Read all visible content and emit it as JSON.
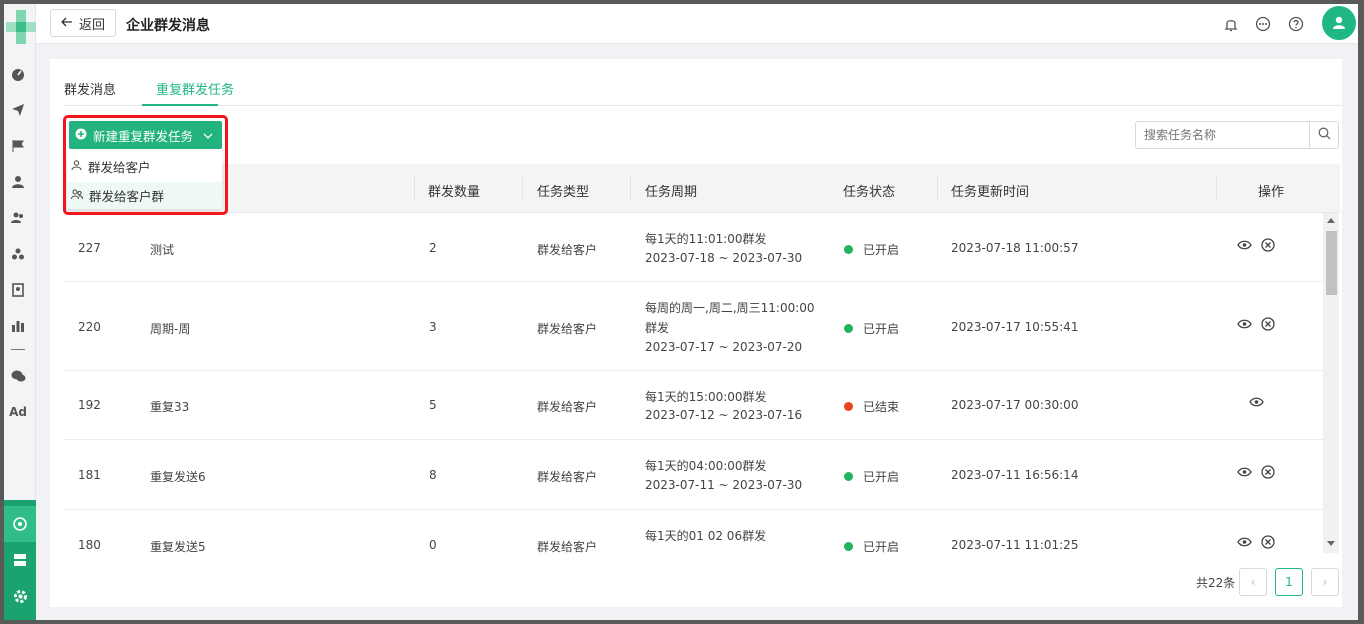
{
  "header": {
    "back_label": "返回",
    "title": "企业群发消息"
  },
  "tabs": [
    {
      "label": "群发消息",
      "active": false
    },
    {
      "label": "重复群发任务",
      "active": true
    }
  ],
  "new_task_dropdown": {
    "button_label": "新建重复群发任务",
    "items": [
      {
        "label": "群发给客户",
        "icon": "user-icon"
      },
      {
        "label": "群发给客户群",
        "icon": "user-group-icon"
      }
    ]
  },
  "search": {
    "placeholder": "搜索任务名称"
  },
  "table": {
    "columns": [
      "群发数量",
      "任务类型",
      "任务周期",
      "任务状态",
      "任务更新时间",
      "操作"
    ],
    "rows": [
      {
        "id": "227",
        "name": "测试",
        "count": "2",
        "type": "群发给客户",
        "period_line1": "每1天的11:01:00群发",
        "period_line2": "",
        "period_range": "2023-07-18 ~ 2023-07-30",
        "status": "已开启",
        "status_color": "#22b35e",
        "updated": "2023-07-18 11:00:57",
        "can_stop": true
      },
      {
        "id": "220",
        "name": "周期-周",
        "count": "3",
        "type": "群发给客户",
        "period_line1": "每周的周一,周二,周三11:00:00",
        "period_line2": "群发",
        "period_range": "2023-07-17 ~ 2023-07-20",
        "status": "已开启",
        "status_color": "#22b35e",
        "updated": "2023-07-17 10:55:41",
        "can_stop": true
      },
      {
        "id": "192",
        "name": "重复33",
        "count": "5",
        "type": "群发给客户",
        "period_line1": "每1天的15:00:00群发",
        "period_line2": "",
        "period_range": "2023-07-12 ~ 2023-07-16",
        "status": "已结束",
        "status_color": "#e8431a",
        "updated": "2023-07-17 00:30:00",
        "can_stop": false
      },
      {
        "id": "181",
        "name": "重复发送6",
        "count": "8",
        "type": "群发给客户",
        "period_line1": "每1天的04:00:00群发",
        "period_line2": "",
        "period_range": "2023-07-11 ~ 2023-07-30",
        "status": "已开启",
        "status_color": "#22b35e",
        "updated": "2023-07-11 16:56:14",
        "can_stop": true
      },
      {
        "id": "180",
        "name": "重复发送5",
        "count": "0",
        "type": "群发给客户",
        "period_line1": "每1天的01 02 06群发",
        "period_line2": "",
        "period_range": "",
        "status": "已开启",
        "status_color": "#22b35e",
        "updated": "2023-07-11 11:01:25",
        "can_stop": true
      }
    ]
  },
  "pagination": {
    "total_label": "共22条",
    "current_page": "1",
    "prev": "‹",
    "next": "›"
  },
  "colors": {
    "brand": "#1fb883",
    "active": "#22b35e",
    "ended": "#e8431a",
    "highlight": "#f2151b"
  }
}
